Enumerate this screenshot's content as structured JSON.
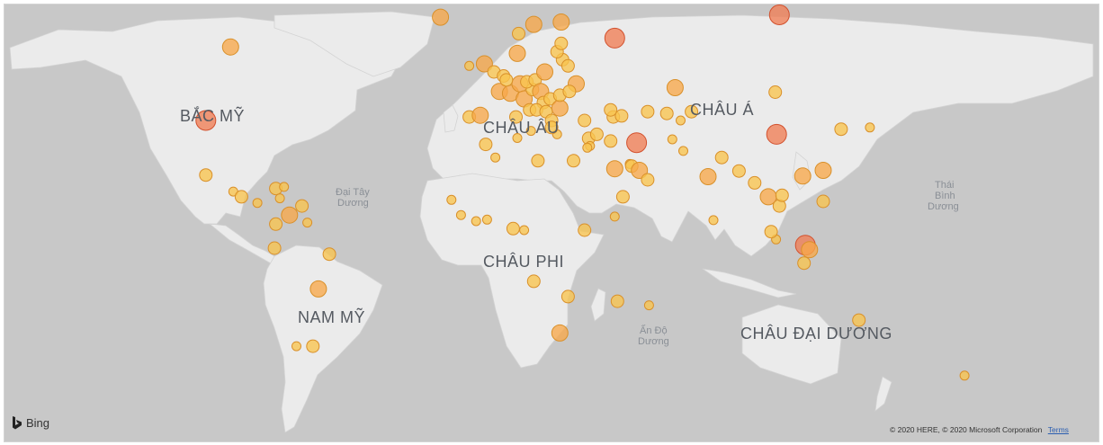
{
  "labels": {
    "north_america": "BẮC MỸ",
    "europe": "CHÂU ÂU",
    "asia": "CHÂU Á",
    "africa": "CHÂU PHI",
    "south_america": "NAM MỸ",
    "oceania": "CHÂU ĐẠI DƯƠNG",
    "atlantic_1": "Đại Tây",
    "atlantic_2": "Dương",
    "indian_1": "Ấn Độ",
    "indian_2": "Dương",
    "pacific_1": "Thái",
    "pacific_2": "Bình",
    "pacific_3": "Dương"
  },
  "branding": {
    "logo_text": "Bing"
  },
  "attribution": {
    "copyright": "© 2020 HERE, © 2020 Microsoft Corporation",
    "terms": "Terms"
  },
  "colors": {
    "ocean": "#c8c8c8",
    "land": "#ebebeb",
    "bubble_small": "#f9c44e",
    "bubble_mid": "#f7a84a",
    "bubble_large": "#f07d55",
    "bubble_stroke": "#d9902a"
  },
  "map_data": {
    "size_scale": "1 smallest - 5 largest",
    "points": [
      {
        "lon": -95.0,
        "lat": 58.0,
        "size": 3
      },
      {
        "lon": -104.0,
        "lat": 39.0,
        "size": 4
      },
      {
        "lon": -104.0,
        "lat": 22.5,
        "size": 2
      },
      {
        "lon": -94.0,
        "lat": 17.2,
        "size": 1
      },
      {
        "lon": -91.0,
        "lat": 15.5,
        "size": 2
      },
      {
        "lon": -85.2,
        "lat": 13.5,
        "size": 1
      },
      {
        "lon": -78.5,
        "lat": 18.2,
        "size": 2
      },
      {
        "lon": -75.5,
        "lat": 18.7,
        "size": 1
      },
      {
        "lon": -77.0,
        "lat": 15.0,
        "size": 1
      },
      {
        "lon": -73.5,
        "lat": 9.5,
        "size": 3
      },
      {
        "lon": -69.0,
        "lat": 12.5,
        "size": 2
      },
      {
        "lon": -67.0,
        "lat": 7.0,
        "size": 1
      },
      {
        "lon": -78.5,
        "lat": 6.5,
        "size": 2
      },
      {
        "lon": -79.0,
        "lat": -1.5,
        "size": 2
      },
      {
        "lon": -59.0,
        "lat": -3.5,
        "size": 2
      },
      {
        "lon": -63.0,
        "lat": -15.0,
        "size": 3
      },
      {
        "lon": -71.0,
        "lat": -33.0,
        "size": 1
      },
      {
        "lon": -65.0,
        "lat": -33.0,
        "size": 2
      },
      {
        "lon": -18.5,
        "lat": 64.5,
        "size": 3
      },
      {
        "lon": -8.0,
        "lat": 53.5,
        "size": 1
      },
      {
        "lon": -2.5,
        "lat": 54.0,
        "size": 3
      },
      {
        "lon": 1.0,
        "lat": 52.0,
        "size": 2
      },
      {
        "lon": 3.0,
        "lat": 47.0,
        "size": 3
      },
      {
        "lon": -8.0,
        "lat": 40.0,
        "size": 2
      },
      {
        "lon": -4.0,
        "lat": 40.5,
        "size": 3
      },
      {
        "lon": 7.0,
        "lat": 46.5,
        "size": 3
      },
      {
        "lon": 10.5,
        "lat": 49.0,
        "size": 3
      },
      {
        "lon": 4.5,
        "lat": 51.0,
        "size": 2
      },
      {
        "lon": 5.5,
        "lat": 50.0,
        "size": 2
      },
      {
        "lon": 9.5,
        "lat": 56.5,
        "size": 3
      },
      {
        "lon": 12.0,
        "lat": 45.0,
        "size": 3
      },
      {
        "lon": 14.0,
        "lat": 42.0,
        "size": 2
      },
      {
        "lon": 15.0,
        "lat": 47.5,
        "size": 2
      },
      {
        "lon": 13.0,
        "lat": 49.5,
        "size": 2
      },
      {
        "lon": 16.0,
        "lat": 50.0,
        "size": 2
      },
      {
        "lon": 18.0,
        "lat": 47.0,
        "size": 3
      },
      {
        "lon": 19.5,
        "lat": 52.0,
        "size": 3
      },
      {
        "lon": 19.0,
        "lat": 44.0,
        "size": 2
      },
      {
        "lon": 21.5,
        "lat": 45.0,
        "size": 2
      },
      {
        "lon": 16.5,
        "lat": 42.0,
        "size": 2
      },
      {
        "lon": 20.0,
        "lat": 41.5,
        "size": 2
      },
      {
        "lon": 25.0,
        "lat": 42.5,
        "size": 3
      },
      {
        "lon": 25.0,
        "lat": 46.0,
        "size": 2
      },
      {
        "lon": 22.0,
        "lat": 39.0,
        "size": 2
      },
      {
        "lon": 24.0,
        "lat": 35.0,
        "size": 1
      },
      {
        "lon": 14.5,
        "lat": 36.0,
        "size": 1
      },
      {
        "lon": 9.0,
        "lat": 40.0,
        "size": 2
      },
      {
        "lon": 26.0,
        "lat": 55.0,
        "size": 2
      },
      {
        "lon": 24.0,
        "lat": 56.9,
        "size": 2
      },
      {
        "lon": 25.5,
        "lat": 58.8,
        "size": 2
      },
      {
        "lon": 28.0,
        "lat": 53.5,
        "size": 2
      },
      {
        "lon": 31.0,
        "lat": 49.0,
        "size": 3
      },
      {
        "lon": 28.5,
        "lat": 47.0,
        "size": 2
      },
      {
        "lon": 15.5,
        "lat": 63.0,
        "size": 3
      },
      {
        "lon": 25.5,
        "lat": 63.5,
        "size": 3
      },
      {
        "lon": 10.0,
        "lat": 61.0,
        "size": 2
      },
      {
        "lon": 45.0,
        "lat": 60.0,
        "size": 4
      },
      {
        "lon": 105.0,
        "lat": 65.0,
        "size": 4
      },
      {
        "lon": 22.0,
        "lat": 37.0,
        "size": 2
      },
      {
        "lon": 34.0,
        "lat": 39.0,
        "size": 2
      },
      {
        "lon": 35.5,
        "lat": 33.8,
        "size": 2
      },
      {
        "lon": 44.5,
        "lat": 40.0,
        "size": 2
      },
      {
        "lon": 43.5,
        "lat": 42.0,
        "size": 2
      },
      {
        "lon": 47.5,
        "lat": 40.3,
        "size": 2
      },
      {
        "lon": 57.0,
        "lat": 41.5,
        "size": 2
      },
      {
        "lon": 67.0,
        "lat": 48.0,
        "size": 3
      },
      {
        "lon": 64.0,
        "lat": 41.0,
        "size": 2
      },
      {
        "lon": 73.0,
        "lat": 41.5,
        "size": 2
      },
      {
        "lon": 69.0,
        "lat": 39.0,
        "size": 1
      },
      {
        "lon": 66.0,
        "lat": 33.5,
        "size": 1
      },
      {
        "lon": 38.5,
        "lat": 35.0,
        "size": 2
      },
      {
        "lon": 43.5,
        "lat": 33.0,
        "size": 2
      },
      {
        "lon": 53.0,
        "lat": 32.5,
        "size": 4
      },
      {
        "lon": 36.0,
        "lat": 31.5,
        "size": 1
      },
      {
        "lon": 35.0,
        "lat": 31.0,
        "size": 1
      },
      {
        "lon": 45.0,
        "lat": 24.5,
        "size": 3
      },
      {
        "lon": 50.5,
        "lat": 26.0,
        "size": 1
      },
      {
        "lon": 51.2,
        "lat": 25.3,
        "size": 2
      },
      {
        "lon": 54.0,
        "lat": 24.0,
        "size": 3
      },
      {
        "lon": 57.0,
        "lat": 21.0,
        "size": 2
      },
      {
        "lon": 48.0,
        "lat": 15.5,
        "size": 2
      },
      {
        "lon": 70.0,
        "lat": 30.0,
        "size": 1
      },
      {
        "lon": 79.0,
        "lat": 22.0,
        "size": 3
      },
      {
        "lon": 81.0,
        "lat": 7.8,
        "size": 1
      },
      {
        "lon": 84.0,
        "lat": 28.0,
        "size": 2
      },
      {
        "lon": 90.3,
        "lat": 23.8,
        "size": 2
      },
      {
        "lon": 96.0,
        "lat": 20.0,
        "size": 2
      },
      {
        "lon": 101.0,
        "lat": 15.5,
        "size": 3
      },
      {
        "lon": 105.0,
        "lat": 12.5,
        "size": 2
      },
      {
        "lon": 106.0,
        "lat": 16.0,
        "size": 2
      },
      {
        "lon": 103.8,
        "lat": 1.4,
        "size": 1
      },
      {
        "lon": 102.0,
        "lat": 4.0,
        "size": 2
      },
      {
        "lon": 113.5,
        "lat": 22.2,
        "size": 3
      },
      {
        "lon": 121.0,
        "lat": 24.0,
        "size": 3
      },
      {
        "lon": 121.0,
        "lat": 14.0,
        "size": 2
      },
      {
        "lon": 114.5,
        "lat": -0.5,
        "size": 4
      },
      {
        "lon": 116.0,
        "lat": -2.0,
        "size": 3
      },
      {
        "lon": 114.0,
        "lat": -6.5,
        "size": 2
      },
      {
        "lon": 104.0,
        "lat": 35.0,
        "size": 4
      },
      {
        "lon": 103.5,
        "lat": 46.8,
        "size": 2
      },
      {
        "lon": 127.5,
        "lat": 36.5,
        "size": 2
      },
      {
        "lon": 138.0,
        "lat": 37.0,
        "size": 1
      },
      {
        "lon": 134.0,
        "lat": -25.0,
        "size": 2
      },
      {
        "lon": 172.5,
        "lat": -41.5,
        "size": 1
      },
      {
        "lon": -2.0,
        "lat": 32.0,
        "size": 2
      },
      {
        "lon": 1.5,
        "lat": 28.0,
        "size": 1
      },
      {
        "lon": 9.5,
        "lat": 33.9,
        "size": 1
      },
      {
        "lon": 17.0,
        "lat": 27.0,
        "size": 2
      },
      {
        "lon": 30.0,
        "lat": 27.0,
        "size": 2
      },
      {
        "lon": -14.5,
        "lat": 14.5,
        "size": 1
      },
      {
        "lon": -11.0,
        "lat": 9.5,
        "size": 1
      },
      {
        "lon": -5.5,
        "lat": 7.5,
        "size": 1
      },
      {
        "lon": -1.5,
        "lat": 8.0,
        "size": 1
      },
      {
        "lon": 8.0,
        "lat": 5.0,
        "size": 2
      },
      {
        "lon": 12.0,
        "lat": 4.5,
        "size": 1
      },
      {
        "lon": 34.0,
        "lat": 4.5,
        "size": 2
      },
      {
        "lon": 15.5,
        "lat": -12.5,
        "size": 2
      },
      {
        "lon": 28.0,
        "lat": -17.5,
        "size": 2
      },
      {
        "lon": 25.0,
        "lat": -29.0,
        "size": 3
      },
      {
        "lon": 46.0,
        "lat": -19.0,
        "size": 2
      },
      {
        "lon": 57.5,
        "lat": -20.3,
        "size": 1
      },
      {
        "lon": 45.0,
        "lat": 9.0,
        "size": 1
      }
    ]
  }
}
